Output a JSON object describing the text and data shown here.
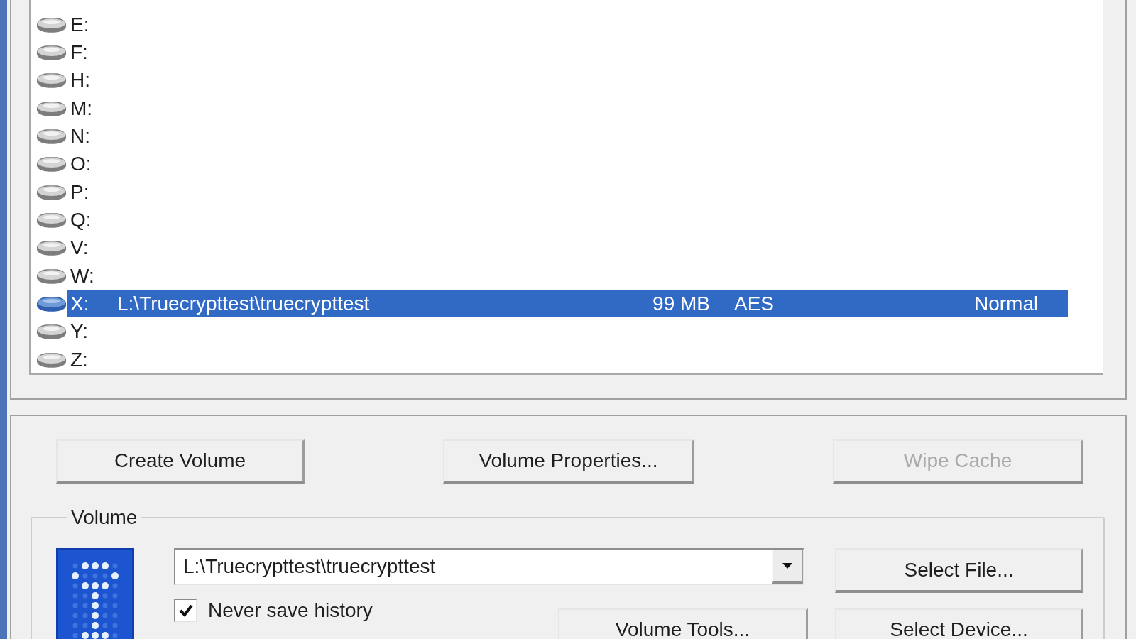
{
  "volume_list": {
    "rows": [
      {
        "cells": [
          "E:"
        ],
        "selected": false
      },
      {
        "cells": [
          "F:"
        ],
        "selected": false
      },
      {
        "cells": [
          "H:"
        ],
        "selected": false
      },
      {
        "cells": [
          "M:"
        ],
        "selected": false
      },
      {
        "cells": [
          "N:"
        ],
        "selected": false
      },
      {
        "cells": [
          "O:"
        ],
        "selected": false
      },
      {
        "cells": [
          "P:"
        ],
        "selected": false
      },
      {
        "cells": [
          "Q:"
        ],
        "selected": false
      },
      {
        "cells": [
          "V:"
        ],
        "selected": false
      },
      {
        "cells": [
          "W:"
        ],
        "selected": false
      },
      {
        "cells": [
          "X:",
          "L:\\Truecrypttest\\truecrypttest",
          "99 MB",
          "AES",
          "Normal"
        ],
        "selected": true
      },
      {
        "cells": [
          "Y:"
        ],
        "selected": false
      },
      {
        "cells": [
          "Z:"
        ],
        "selected": false
      }
    ]
  },
  "buttons": [
    {
      "label": "Create Volume",
      "disabled": false
    },
    {
      "label": "Volume Properties...",
      "disabled": false
    },
    {
      "label": "Wipe Cache",
      "disabled": true
    }
  ],
  "volume": {
    "legend": "Volume",
    "path": {
      "value": "L:\\Truecrypttest\\truecrypttest"
    },
    "select_file": {
      "label": "Select File..."
    },
    "never_save_history": {
      "label": "Never save history",
      "checked": true
    },
    "volume_tools": {
      "label": "Volume Tools..."
    },
    "select_device": {
      "label": "Select Device..."
    }
  }
}
